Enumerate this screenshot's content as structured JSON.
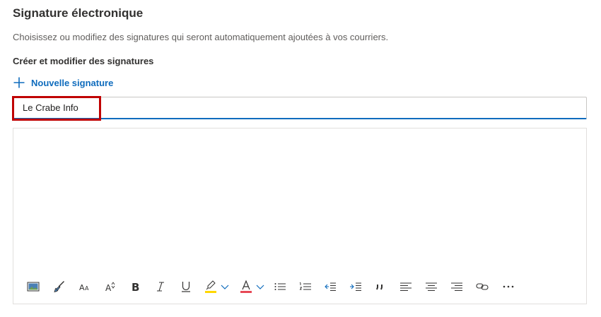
{
  "page": {
    "title": "Signature électronique",
    "description": "Choisissez ou modifiez des signatures qui seront automatiquement ajoutées à vos courriers.",
    "section_label": "Créer et modifier des signatures",
    "new_signature_label": "Nouvelle signature"
  },
  "signature": {
    "name_value": "Le Crabe Info"
  },
  "toolbar": {
    "buttons": [
      {
        "name": "insert-image",
        "icon": "image-icon"
      },
      {
        "name": "format-painter",
        "icon": "paintbrush-icon"
      },
      {
        "name": "font-size",
        "icon": "font-size-icon"
      },
      {
        "name": "text-effects",
        "icon": "text-effects-icon"
      },
      {
        "name": "bold",
        "icon": "bold-icon"
      },
      {
        "name": "italic",
        "icon": "italic-icon"
      },
      {
        "name": "underline",
        "icon": "underline-icon"
      },
      {
        "name": "highlight",
        "icon": "highlighter-icon"
      },
      {
        "name": "highlight-dropdown",
        "icon": "chevron-down-icon"
      },
      {
        "name": "font-color",
        "icon": "font-color-icon"
      },
      {
        "name": "font-color-dropdown",
        "icon": "chevron-down-icon"
      },
      {
        "name": "bulleted-list",
        "icon": "bullet-list-icon"
      },
      {
        "name": "numbered-list",
        "icon": "numbered-list-icon"
      },
      {
        "name": "decrease-indent",
        "icon": "outdent-icon"
      },
      {
        "name": "increase-indent",
        "icon": "indent-icon"
      },
      {
        "name": "quote",
        "icon": "quote-icon"
      },
      {
        "name": "align-left",
        "icon": "align-left-icon"
      },
      {
        "name": "align-center",
        "icon": "align-center-icon"
      },
      {
        "name": "align-right",
        "icon": "align-right-icon"
      },
      {
        "name": "insert-link",
        "icon": "link-icon"
      },
      {
        "name": "more-options",
        "icon": "more-icon"
      }
    ]
  },
  "colors": {
    "accent": "#0f6cbd",
    "highlight_box": "#c00000",
    "highlighter_yellow": "#ffd700",
    "font_color_red": "#e74856"
  }
}
